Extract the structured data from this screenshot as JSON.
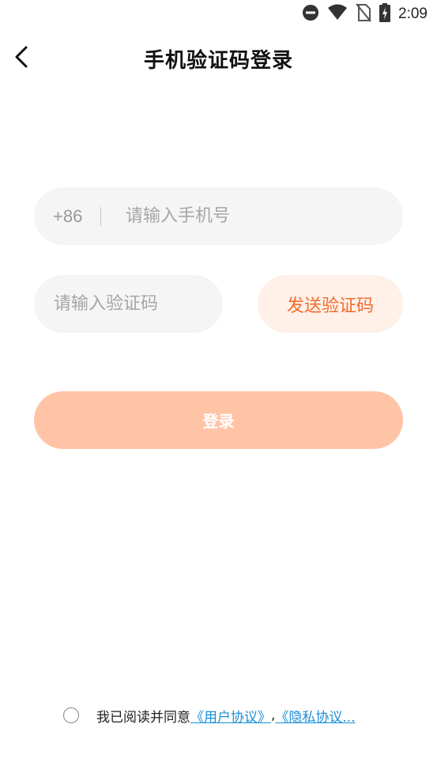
{
  "status_bar": {
    "time": "2:09",
    "icons": [
      "do-not-disturb-icon",
      "wifi-icon",
      "no-sim-icon",
      "battery-charging-icon"
    ]
  },
  "nav": {
    "back_icon": "chevron-left-icon",
    "title": "手机验证码登录"
  },
  "form": {
    "country_code": "+86",
    "phone_placeholder": "请输入手机号",
    "code_placeholder": "请输入验证码",
    "send_code_label": "发送验证码",
    "login_label": "登录"
  },
  "agreement": {
    "text": "我已阅读并同意",
    "user_agreement": "《用户协议》",
    "separator": ",",
    "privacy_policy": "《隐私协议..."
  },
  "colors": {
    "accent": "#f26b2c",
    "accent_light": "#fff0e8",
    "login_button": "#ffc4a6",
    "field_bg": "#f5f5f5",
    "link": "#1a8fd6"
  }
}
